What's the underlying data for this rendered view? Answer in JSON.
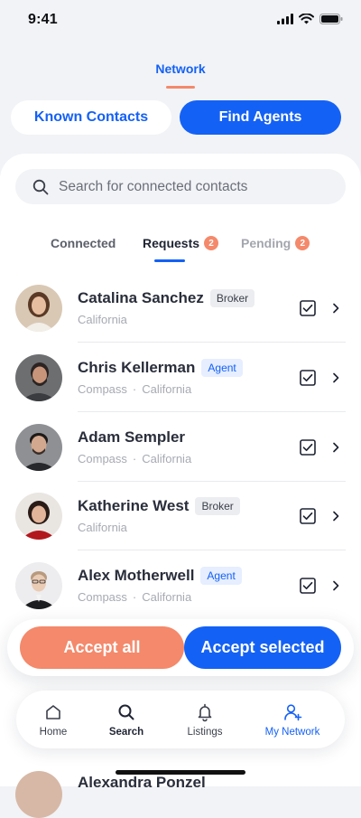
{
  "status": {
    "time": "9:41"
  },
  "header": {
    "title": "Network"
  },
  "segments": {
    "known": "Known Contacts",
    "find": "Find Agents"
  },
  "search": {
    "placeholder": "Search for connected contacts"
  },
  "tabs": {
    "connected": "Connected",
    "requests": "Requests",
    "requests_count": "2",
    "pending": "Pending",
    "pending_count": "2"
  },
  "contacts": [
    {
      "name": "Catalina Sanchez",
      "role": "Broker",
      "company": "",
      "location": "California",
      "checked": true
    },
    {
      "name": "Chris Kellerman",
      "role": "Agent",
      "company": "Compass",
      "location": "California",
      "checked": true
    },
    {
      "name": "Adam Sempler",
      "role": "",
      "company": "Compass",
      "location": "California",
      "checked": true
    },
    {
      "name": "Katherine West",
      "role": "Broker",
      "company": "",
      "location": "California",
      "checked": true
    },
    {
      "name": "Alex Motherwell",
      "role": "Agent",
      "company": "Compass",
      "location": "California",
      "checked": true
    }
  ],
  "peek": {
    "name": "Alexandra Ponzel"
  },
  "actions": {
    "accept_all": "Accept all",
    "accept_selected": "Accept selected"
  },
  "nav": {
    "home": "Home",
    "search": "Search",
    "listings": "Listings",
    "network": "My Network"
  },
  "colors": {
    "primary": "#1461F5",
    "accent": "#F4896B",
    "background": "#F2F3F6"
  }
}
